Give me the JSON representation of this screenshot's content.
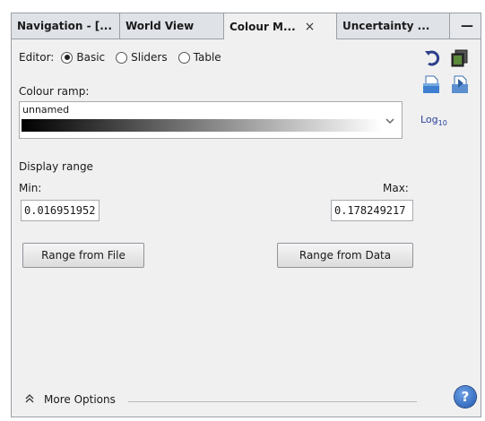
{
  "tabs": [
    {
      "label": "Navigation - [..."
    },
    {
      "label": "World View"
    },
    {
      "label": "Colour M...",
      "close": "×"
    },
    {
      "label": "Uncertainty ..."
    }
  ],
  "tab_menu_label": "—",
  "editor": {
    "label": "Editor:",
    "options": [
      "Basic",
      "Sliders",
      "Table"
    ],
    "selected": "Basic"
  },
  "colour_ramp": {
    "label": "Colour ramp:",
    "name": "unnamed",
    "log_label": "Log",
    "log_sub": "10"
  },
  "display_range": {
    "heading": "Display range",
    "min_label": "Min:",
    "max_label": "Max:",
    "min_value": "0.016951952",
    "max_value": "0.178249217"
  },
  "buttons": {
    "range_from_file": "Range from File",
    "range_from_data": "Range from Data"
  },
  "footer": {
    "more_options": "More Options",
    "help_glyph": "?"
  },
  "icons": [
    "reset-icon",
    "copy-icon",
    "open-file-icon",
    "save-icon",
    "chevron-down-icon",
    "expand-icon",
    "help-icon"
  ],
  "colors": {
    "accent": "#2a6ebb",
    "ramp_start": "#000000",
    "ramp_end": "#ffffff"
  }
}
